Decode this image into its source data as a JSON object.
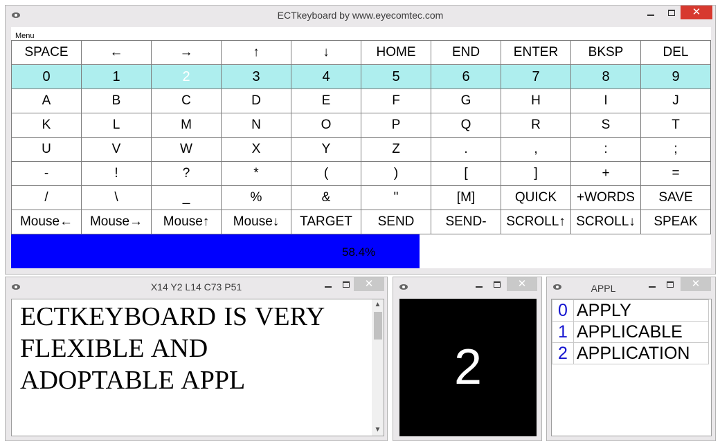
{
  "main_window": {
    "title": "ECTkeyboard by www.eyecomtec.com",
    "controls": {
      "minimize": "",
      "maximize": "",
      "close": "✕"
    },
    "menu": {
      "label": "Menu"
    },
    "keyboard": {
      "rows": [
        [
          "SPACE",
          "←",
          "→",
          "↑",
          "↓",
          "HOME",
          "END",
          "ENTER",
          "BKSP",
          "DEL"
        ],
        [
          "0",
          "1",
          "2",
          "3",
          "4",
          "5",
          "6",
          "7",
          "8",
          "9"
        ],
        [
          "A",
          "B",
          "C",
          "D",
          "E",
          "F",
          "G",
          "H",
          "I",
          "J"
        ],
        [
          "K",
          "L",
          "M",
          "N",
          "O",
          "P",
          "Q",
          "R",
          "S",
          "T"
        ],
        [
          "U",
          "V",
          "W",
          "X",
          "Y",
          "Z",
          ".",
          ",",
          ":",
          ";"
        ],
        [
          "-",
          "!",
          "?",
          "*",
          "(",
          ")",
          "[",
          "]",
          "+",
          "="
        ],
        [
          "/",
          "\\",
          "_",
          "%",
          "&",
          "\"",
          "[M]",
          "QUICK",
          "+WORDS",
          "SAVE"
        ],
        [
          "Mouse←",
          "Mouse→",
          "Mouse↑",
          "Mouse↓",
          "TARGET",
          "SEND",
          "SEND-",
          "SCROLL↑",
          "SCROLL↓",
          "SPEAK"
        ]
      ],
      "selected_key": "2",
      "highlight_row_color": "#aeeeee",
      "selected_color": "#0000ff"
    },
    "progress": {
      "value_percent": 58.4,
      "label": "58.4%",
      "fill_color": "#0000ff"
    }
  },
  "editor_window": {
    "title": "X14  Y2  L14  C73  P51",
    "controls": {
      "minimize": "",
      "maximize": "",
      "close": "✕"
    },
    "text": "ECTKEYBOARD IS VERY FLEXIBLE AND ADOPTABLE APPL"
  },
  "digit_window": {
    "title": "",
    "controls": {
      "minimize": "",
      "maximize": "",
      "close": "✕"
    },
    "digit": "2"
  },
  "word_window": {
    "title": "APPL",
    "controls": {
      "minimize": "",
      "maximize": "",
      "close": "✕"
    },
    "words": [
      {
        "index": "0",
        "word": "APPLY"
      },
      {
        "index": "1",
        "word": "APPLICABLE"
      },
      {
        "index": "2",
        "word": "APPLICATION"
      }
    ]
  }
}
